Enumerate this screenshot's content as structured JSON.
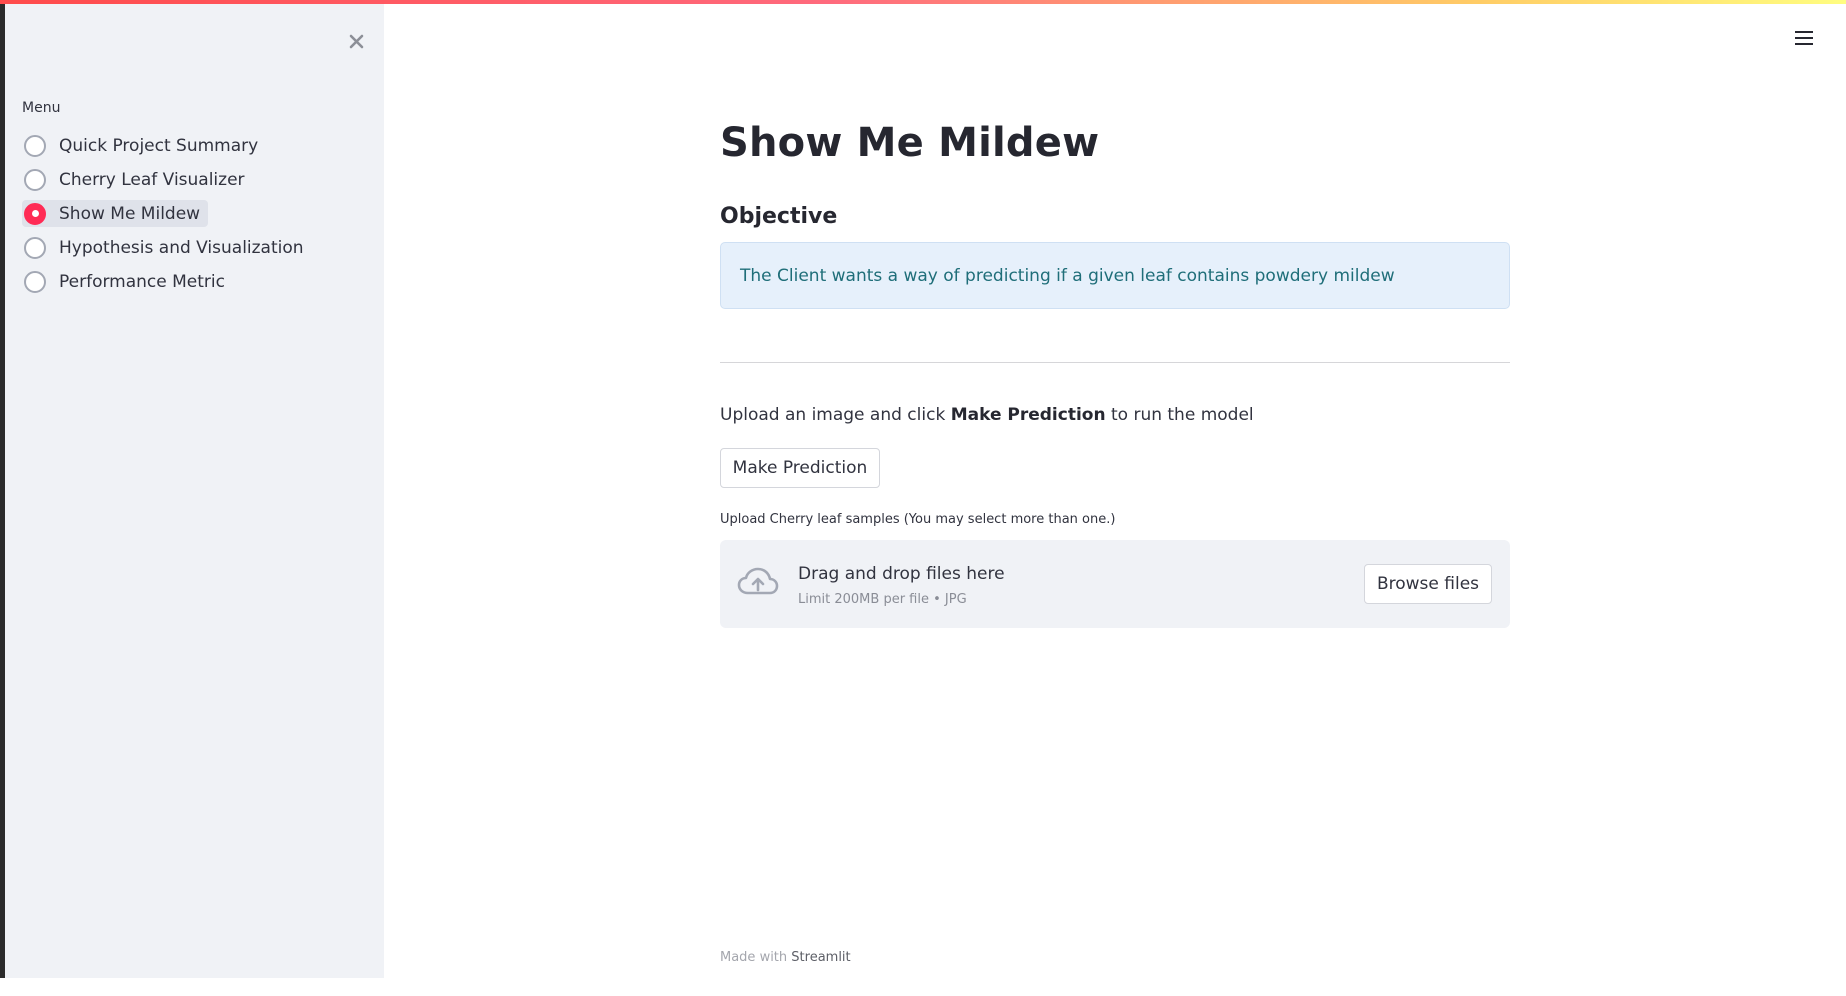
{
  "sidebar": {
    "close_icon": "close-icon",
    "menu_label": "Menu",
    "items": [
      {
        "label": "Quick Project Summary",
        "selected": false
      },
      {
        "label": "Cherry Leaf Visualizer",
        "selected": false
      },
      {
        "label": "Show Me Mildew",
        "selected": true
      },
      {
        "label": "Hypothesis and Visualization",
        "selected": false
      },
      {
        "label": "Performance Metric",
        "selected": false
      }
    ]
  },
  "header": {
    "menu_icon": "hamburger-menu-icon"
  },
  "main": {
    "title": "Show Me Mildew",
    "objective_heading": "Objective",
    "info_text": "The Client wants a way of predicting if a given leaf contains powdery mildew",
    "instruction": {
      "before": "Upload an image and click ",
      "bold": "Make Prediction",
      "after": " to run the model"
    },
    "predict_button_label": "Make Prediction",
    "uploader": {
      "label": "Upload Cherry leaf samples (You may select more than one.)",
      "drop_title": "Drag and drop files here",
      "limit_text": "Limit 200MB per file • JPG",
      "browse_button_label": "Browse files",
      "icon": "cloud-upload-icon"
    }
  },
  "footer": {
    "prefix": "Made with ",
    "brand": "Streamlit"
  },
  "colors": {
    "accent": "#ff2b55",
    "sidebar_bg": "#f0f2f6",
    "info_bg": "#e6f0fb",
    "info_text": "#1f6e79"
  }
}
